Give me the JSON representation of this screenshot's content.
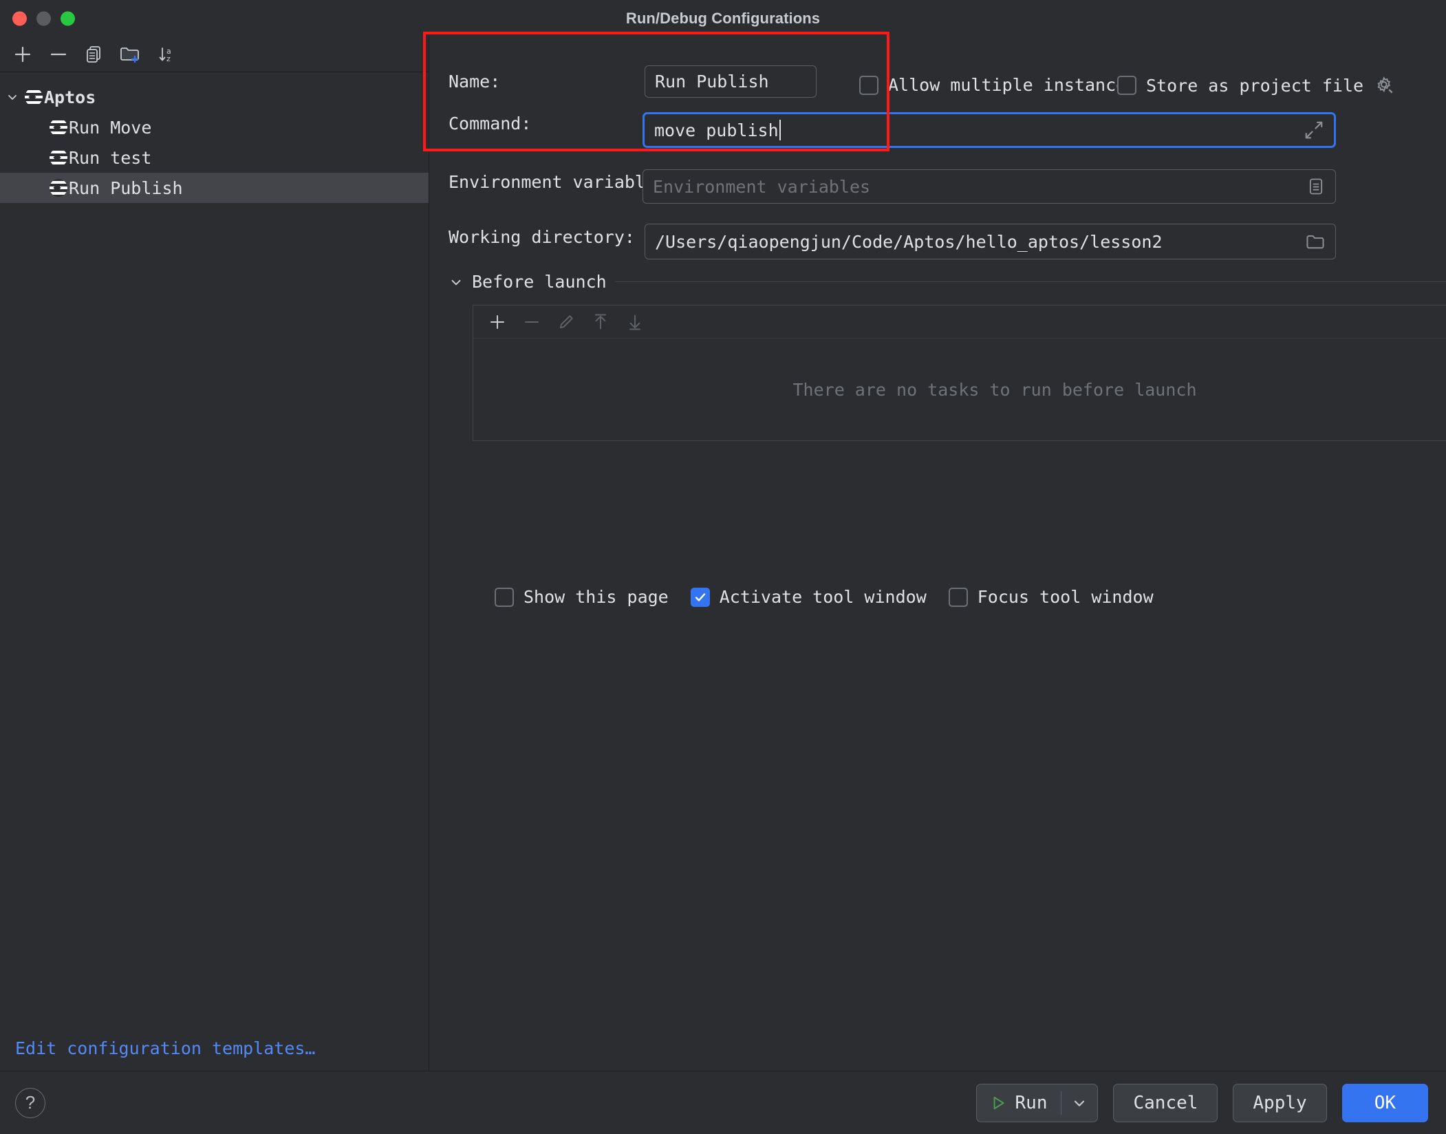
{
  "window": {
    "title": "Run/Debug Configurations",
    "accent": "#3574f0",
    "annotation_color": "#ff1a1a",
    "background": "#2b2d30"
  },
  "toolbar": {
    "buttons": [
      {
        "name": "add-configuration-button",
        "icon": "plus-icon"
      },
      {
        "name": "remove-configuration-button",
        "icon": "minus-icon"
      },
      {
        "name": "copy-configuration-button",
        "icon": "copy-icon"
      },
      {
        "name": "new-folder-button",
        "icon": "new-folder-icon"
      },
      {
        "name": "sort-configurations-button",
        "icon": "sort-alpha-icon"
      }
    ]
  },
  "sidebar": {
    "items": [
      {
        "label": "Aptos",
        "level": 0,
        "expanded": true,
        "selected": false
      },
      {
        "label": "Run Move",
        "level": 1,
        "expanded": false,
        "selected": false
      },
      {
        "label": "Run test",
        "level": 1,
        "expanded": false,
        "selected": false
      },
      {
        "label": "Run Publish",
        "level": 1,
        "expanded": false,
        "selected": true
      }
    ],
    "edit_templates_link": "Edit configuration templates…"
  },
  "form": {
    "name": {
      "label": "Name:",
      "value": "Run Publish"
    },
    "allow_multiple_instances": {
      "label": "Allow multiple instances",
      "checked": false
    },
    "store_as_project_file": {
      "label": "Store as project file",
      "checked": false,
      "gear_icon": "gear-icon"
    },
    "command": {
      "label": "Command:",
      "value": "move publish",
      "focused": true,
      "expand_icon": "expand-diagonal-icon"
    },
    "environment_variables": {
      "label": "Environment variables:",
      "value": "",
      "placeholder": "Environment variables",
      "browse_icon": "list-document-icon"
    },
    "working_directory": {
      "label": "Working directory:",
      "value": "/Users/qiaopengjun/Code/Aptos/hello_aptos/lesson2",
      "browse_icon": "folder-icon"
    }
  },
  "before_launch": {
    "title": "Before launch",
    "expanded": true,
    "empty_message": "There are no tasks to run before launch",
    "tasks": [],
    "tools": [
      {
        "name": "add-task-button",
        "icon": "plus-icon",
        "enabled": true
      },
      {
        "name": "remove-task-button",
        "icon": "minus-icon",
        "enabled": false
      },
      {
        "name": "edit-task-button",
        "icon": "pencil-icon",
        "enabled": false
      },
      {
        "name": "move-task-up-button",
        "icon": "arrow-up-icon",
        "enabled": false
      },
      {
        "name": "move-task-down-button",
        "icon": "arrow-down-icon",
        "enabled": false
      }
    ],
    "options": [
      {
        "label": "Show this page",
        "checked": false
      },
      {
        "label": "Activate tool window",
        "checked": true
      },
      {
        "label": "Focus tool window",
        "checked": false
      }
    ]
  },
  "footer": {
    "help_label": "?",
    "run_label": "Run",
    "run_icon": "play-triangle-icon",
    "run_dropdown_icon": "chevron-down-icon",
    "cancel_label": "Cancel",
    "apply_label": "Apply",
    "ok_label": "OK"
  }
}
